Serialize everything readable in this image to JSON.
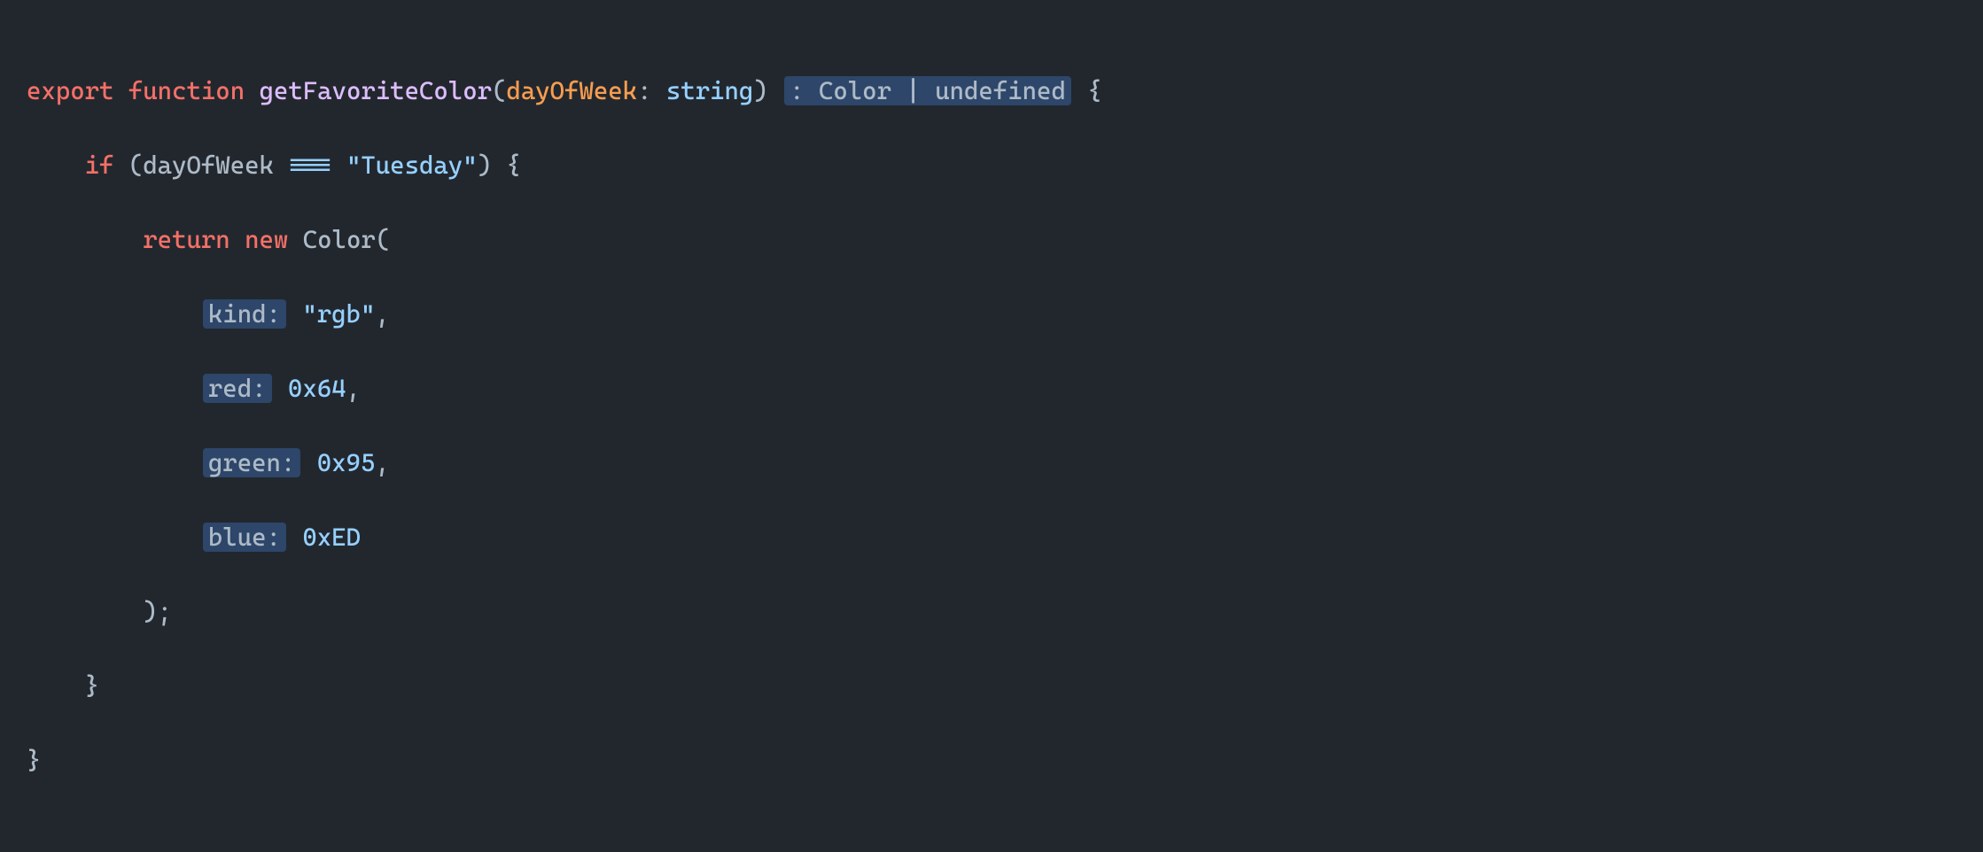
{
  "code": {
    "line1": {
      "export": "export",
      "function": "function",
      "fnName": "getFavoriteColor",
      "lparen": "(",
      "param": "dayOfWeek",
      "colon1": ":",
      "paramType": "string",
      "rparen": ")",
      "hintReturn": ": Color | undefined",
      "lbrace": "{"
    },
    "line2": {
      "if": "if",
      "lparen": "(",
      "var": "dayOfWeek",
      "eq": "===",
      "str": "\"Tuesday\"",
      "rparen": ")",
      "lbrace": "{"
    },
    "line3": {
      "return": "return",
      "new": "new",
      "className": "Color",
      "lparen": "("
    },
    "line4": {
      "hintLabel": "kind:",
      "val": "\"rgb\"",
      "comma": ","
    },
    "line5": {
      "hintLabel": "red:",
      "val": "0x64",
      "comma": ","
    },
    "line6": {
      "hintLabel": "green:",
      "val": "0x95",
      "comma": ","
    },
    "line7": {
      "hintLabel": "blue:",
      "val": "0xED"
    },
    "line8": {
      "rparen": ")",
      "semi": ";"
    },
    "line9": {
      "rbrace": "}"
    },
    "line10": {
      "rbrace": "}"
    }
  }
}
